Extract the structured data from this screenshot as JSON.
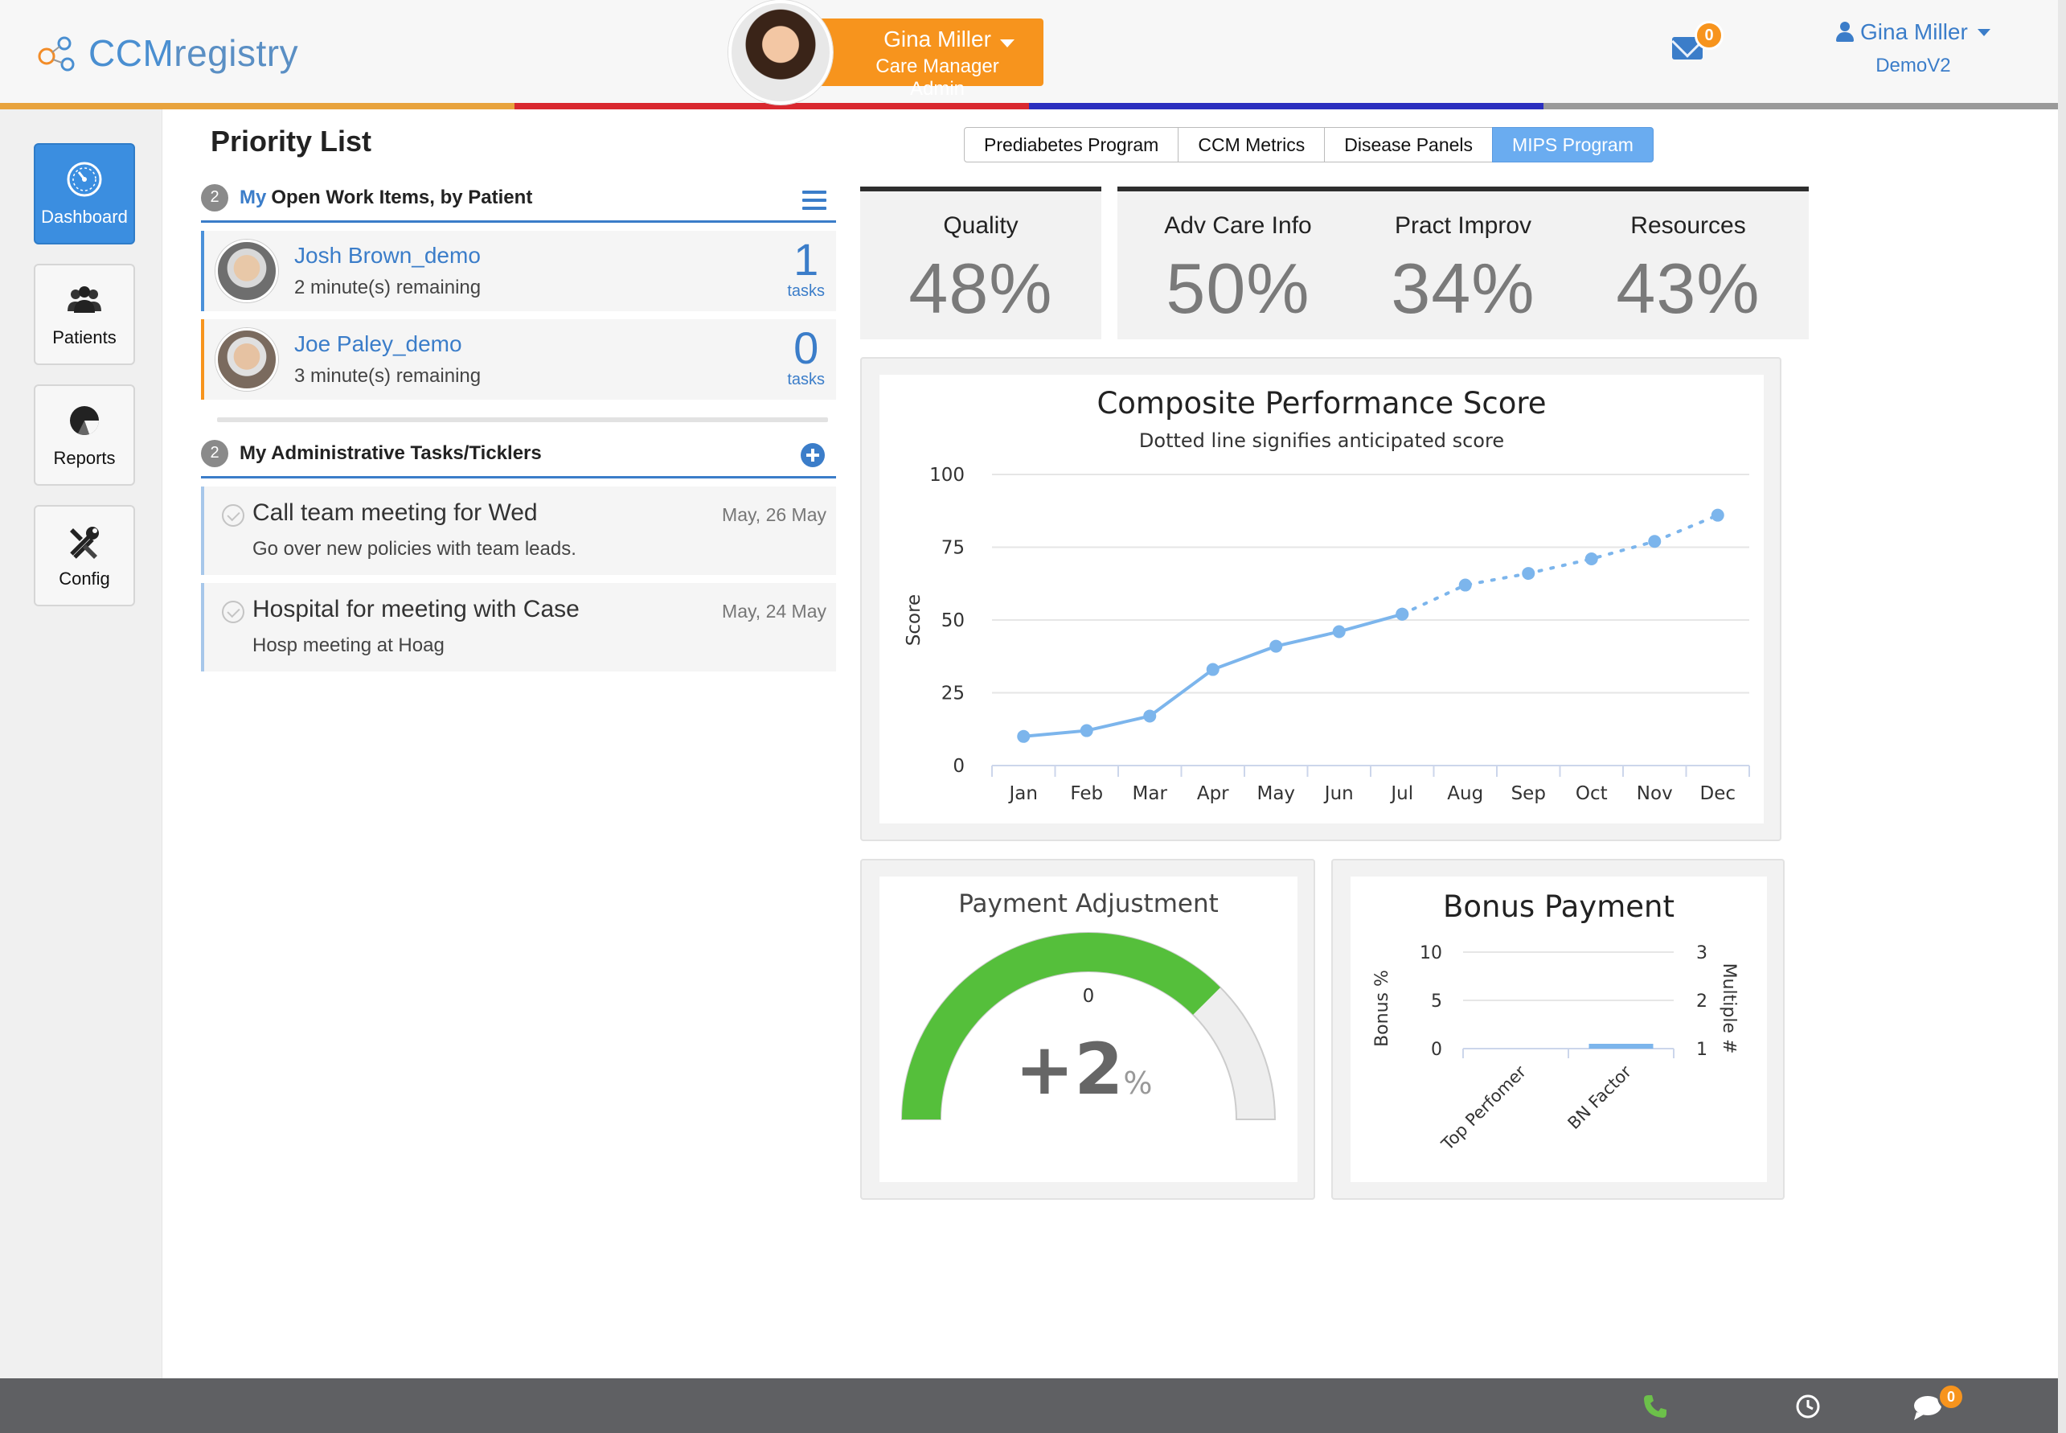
{
  "brand": {
    "logo_text_a": "CCM",
    "logo_text_b": "registry"
  },
  "user_badge": {
    "name": "Gina Miller",
    "role": "Care Manager Admin"
  },
  "messages": {
    "count": "0"
  },
  "account": {
    "name": "Gina Miller",
    "org": "DemoV2"
  },
  "nav": [
    {
      "label": "Dashboard",
      "icon": "gauge-icon",
      "active": true
    },
    {
      "label": "Patients",
      "icon": "people-icon"
    },
    {
      "label": "Reports",
      "icon": "pie-icon"
    },
    {
      "label": "Config",
      "icon": "tools-icon"
    }
  ],
  "priority": {
    "title": "Priority List",
    "work_items": {
      "count": "2",
      "my": "My",
      "label": "Open Work Items, by Patient",
      "patients": [
        {
          "name": "Josh Brown_demo",
          "remaining": "2 minute(s) remaining",
          "tasks": "1",
          "tasks_label": "tasks"
        },
        {
          "name": "Joe Paley_demo",
          "remaining": "3 minute(s) remaining",
          "tasks": "0",
          "tasks_label": "tasks"
        }
      ]
    },
    "admin_tasks": {
      "count": "2",
      "label": "My Administrative Tasks/Ticklers",
      "items": [
        {
          "title": "Call team meeting for Wed",
          "desc": "Go over new policies with team leads.",
          "date": "May, 26 May"
        },
        {
          "title": "Hospital for meeting with Case",
          "desc": "Hosp meeting at Hoag",
          "date": "May, 24 May"
        }
      ]
    }
  },
  "tabs": [
    "Prediabetes Program",
    "CCM Metrics",
    "Disease Panels",
    "MIPS Program"
  ],
  "active_tab": "MIPS Program",
  "stats": [
    {
      "label": "Quality",
      "value": "48%"
    },
    {
      "label": "Adv Care Info",
      "value": "50%"
    },
    {
      "label": "Pract Improv",
      "value": "34%"
    },
    {
      "label": "Resources",
      "value": "43%"
    }
  ],
  "chart_data": [
    {
      "type": "line",
      "title": "Composite Performance Score",
      "subtitle": "Dotted line signifies anticipated score",
      "ylabel": "Score",
      "xlabel": "",
      "ylim": [
        0,
        100
      ],
      "yticks": [
        0,
        25,
        50,
        75,
        100
      ],
      "grid": true,
      "categories": [
        "Jan",
        "Feb",
        "Mar",
        "Apr",
        "May",
        "Jun",
        "Jul",
        "Aug",
        "Sep",
        "Oct",
        "Nov",
        "Dec"
      ],
      "series": [
        {
          "values": [
            10,
            12,
            17,
            33,
            41,
            46,
            52,
            null,
            null,
            null,
            null,
            null
          ],
          "style": "solid"
        },
        {
          "values": [
            null,
            null,
            null,
            null,
            null,
            null,
            52,
            62,
            66,
            71,
            77,
            86
          ],
          "style": "dotted"
        }
      ],
      "color": "#7cb5ec"
    },
    {
      "type": "gauge",
      "title": "Payment Adjustment",
      "min_label": "0",
      "value": 2,
      "value_label": "+2",
      "unit": "%",
      "fill_fraction": 0.75,
      "fill_color": "#55bf3b",
      "track_color": "#eeeeee"
    },
    {
      "type": "bar",
      "title": "Bonus Payment",
      "categories": [
        "Top Perfomer",
        "BN Factor"
      ],
      "values": [
        0,
        0.5
      ],
      "ylabel": "Bonus %",
      "ylim": [
        0,
        10
      ],
      "yticks": [
        0,
        5,
        10
      ],
      "y2label": "Multiple #",
      "y2ticks": [
        1,
        2,
        3
      ],
      "color": "#7cb5ec"
    }
  ],
  "footer": {
    "chat_count": "0"
  },
  "colors": {
    "accent": "#3b7dc9",
    "orange": "#f7941d",
    "strip": [
      "#e8a33d",
      "#d9282f",
      "#2b2fbf",
      "#9a9a9a"
    ]
  }
}
